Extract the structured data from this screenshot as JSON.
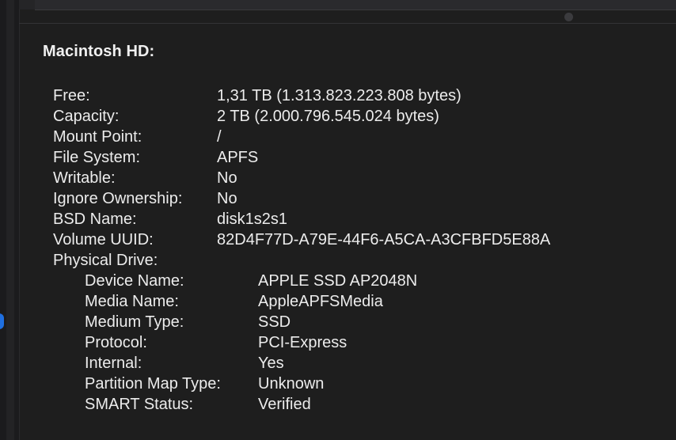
{
  "volume": {
    "title": "Macintosh HD:"
  },
  "properties": [
    {
      "label": "Free:",
      "value": "1,31 TB (1.313.823.223.808 bytes)"
    },
    {
      "label": "Capacity:",
      "value": "2 TB (2.000.796.545.024 bytes)"
    },
    {
      "label": "Mount Point:",
      "value": "/"
    },
    {
      "label": "File System:",
      "value": "APFS"
    },
    {
      "label": "Writable:",
      "value": "No"
    },
    {
      "label": "Ignore Ownership:",
      "value": "No"
    },
    {
      "label": "BSD Name:",
      "value": "disk1s2s1"
    },
    {
      "label": "Volume UUID:",
      "value": "82D4F77D-A79E-44F6-A5CA-A3CFBFD5E88A"
    },
    {
      "label": "Physical Drive:",
      "value": ""
    }
  ],
  "physical_drive": [
    {
      "label": "Device Name:",
      "value": "APPLE SSD AP2048N"
    },
    {
      "label": "Media Name:",
      "value": "AppleAPFSMedia"
    },
    {
      "label": "Medium Type:",
      "value": "SSD"
    },
    {
      "label": "Protocol:",
      "value": "PCI-Express"
    },
    {
      "label": "Internal:",
      "value": "Yes"
    },
    {
      "label": "Partition Map Type:",
      "value": "Unknown"
    },
    {
      "label": "SMART Status:",
      "value": "Verified"
    }
  ],
  "colors": {
    "background": "#1e1e1e",
    "text": "#ececec",
    "accent_dot": "#1f6fe0"
  }
}
